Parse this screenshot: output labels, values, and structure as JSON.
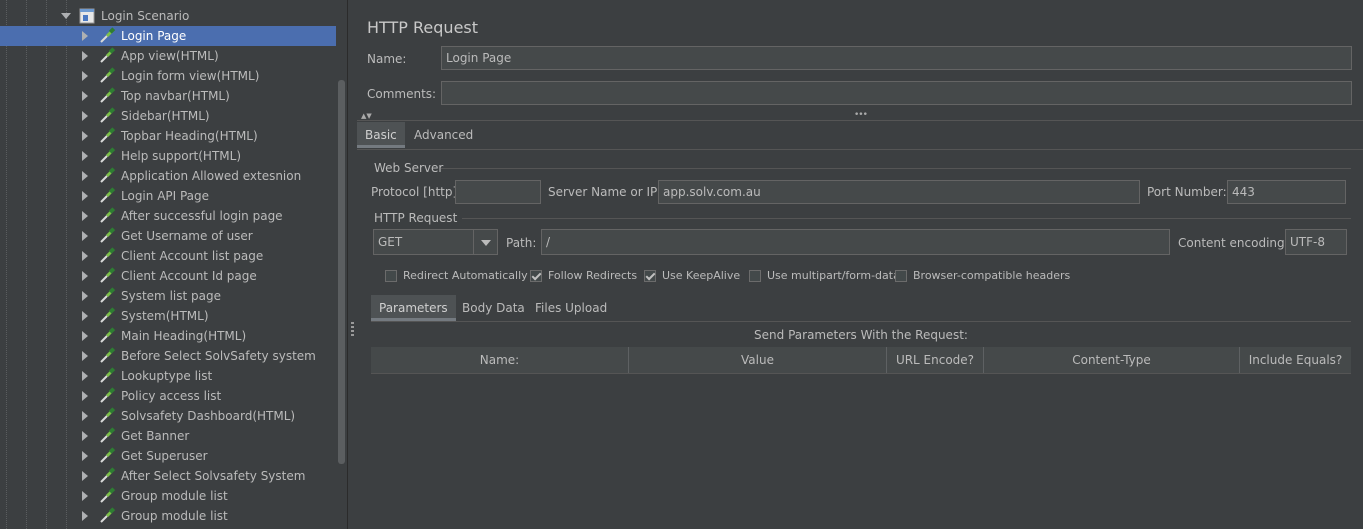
{
  "tree": {
    "root_label": "Login Scenario",
    "items": [
      {
        "label": "Login Page",
        "selected": true
      },
      {
        "label": "App view(HTML)"
      },
      {
        "label": "Login form view(HTML)"
      },
      {
        "label": "Top navbar(HTML)"
      },
      {
        "label": "Sidebar(HTML)"
      },
      {
        "label": "Topbar Heading(HTML)"
      },
      {
        "label": "Help support(HTML)"
      },
      {
        "label": "Application Allowed extesnion"
      },
      {
        "label": "Login API Page"
      },
      {
        "label": "After successful login page"
      },
      {
        "label": "Get Username of user"
      },
      {
        "label": "Client Account list page"
      },
      {
        "label": "Client Account Id page"
      },
      {
        "label": "System list page"
      },
      {
        "label": "System(HTML)"
      },
      {
        "label": "Main Heading(HTML)"
      },
      {
        "label": "Before Select SolvSafety system"
      },
      {
        "label": "Lookuptype list"
      },
      {
        "label": "Policy access list"
      },
      {
        "label": "Solvsafety Dashboard(HTML)"
      },
      {
        "label": "Get Banner"
      },
      {
        "label": "Get Superuser"
      },
      {
        "label": "After Select Solvsafety System"
      },
      {
        "label": "Group module list"
      },
      {
        "label": "Group module list"
      }
    ]
  },
  "panel": {
    "title": "HTTP Request",
    "name_label": "Name:",
    "name_value": "Login Page",
    "comments_label": "Comments:",
    "comments_value": "",
    "tabs": [
      {
        "label": "Basic"
      },
      {
        "label": "Advanced"
      }
    ],
    "web_server": {
      "section_label": "Web Server",
      "protocol_label": "Protocol [http]:",
      "protocol_value": "",
      "server_label": "Server Name or IP:",
      "server_value": "app.solv.com.au",
      "port_label": "Port Number:",
      "port_value": "443"
    },
    "http_request": {
      "section_label": "HTTP Request",
      "method": "GET",
      "path_label": "Path:",
      "path_value": "/",
      "encoding_label": "Content encoding:",
      "encoding_value": "UTF-8"
    },
    "options": [
      {
        "label": "Redirect Automatically",
        "checked": false
      },
      {
        "label": "Follow Redirects",
        "checked": true
      },
      {
        "label": "Use KeepAlive",
        "checked": true
      },
      {
        "label": "Use multipart/form-data",
        "checked": false
      },
      {
        "label": "Browser-compatible headers",
        "checked": false
      }
    ],
    "sub_tabs": [
      {
        "label": "Parameters"
      },
      {
        "label": "Body Data"
      },
      {
        "label": "Files Upload"
      }
    ],
    "params_caption": "Send Parameters With the Request:",
    "columns": [
      {
        "label": "Name:"
      },
      {
        "label": "Value"
      },
      {
        "label": "URL Encode?"
      },
      {
        "label": "Content-Type"
      },
      {
        "label": "Include Equals?"
      }
    ]
  },
  "colors": {
    "background": "#3c3f41",
    "selection": "#4b6eaf",
    "field": "#45494a"
  },
  "icons": {
    "root": "test-fragment-icon",
    "item": "sampler-pipette-icon"
  }
}
